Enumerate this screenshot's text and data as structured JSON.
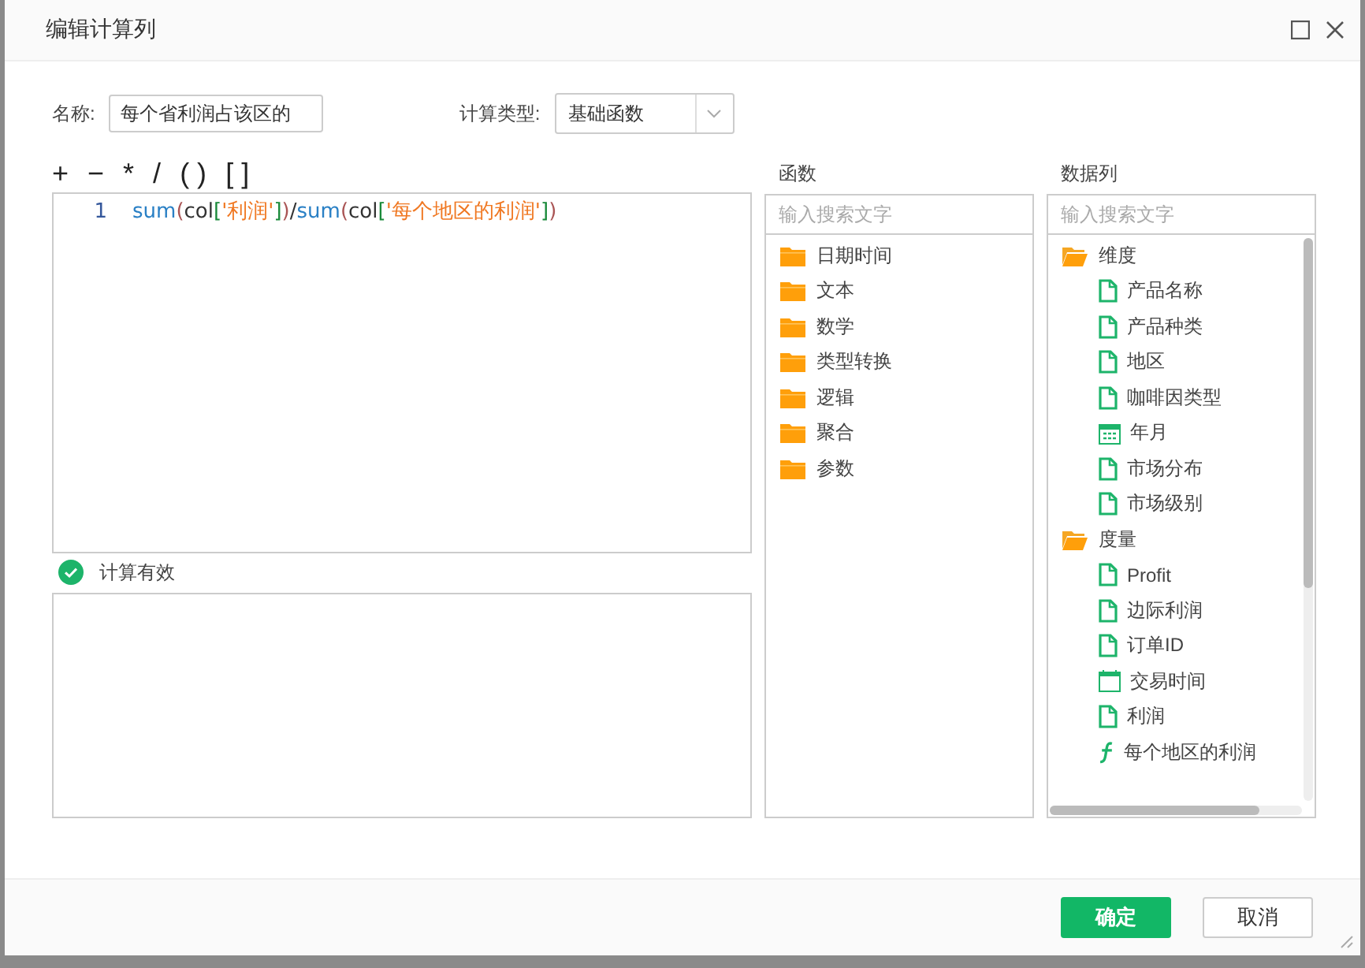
{
  "window": {
    "title": "编辑计算列"
  },
  "name_field": {
    "label": "名称:",
    "value": "每个省利润占该区的"
  },
  "calc_type": {
    "label": "计算类型:",
    "value": "基础函数"
  },
  "operators": [
    "+",
    "−",
    "*",
    "/",
    "( )",
    "[ ]"
  ],
  "editor": {
    "lines": [
      {
        "number": "1",
        "tokens": [
          {
            "kind": "func",
            "text": "sum"
          },
          {
            "kind": "paren",
            "text": "("
          },
          {
            "kind": "plain",
            "text": "col"
          },
          {
            "kind": "bracket",
            "text": "["
          },
          {
            "kind": "string",
            "text": "'利润'"
          },
          {
            "kind": "bracket",
            "text": "]"
          },
          {
            "kind": "paren",
            "text": ")"
          },
          {
            "kind": "plain",
            "text": "/"
          },
          {
            "kind": "func",
            "text": "sum"
          },
          {
            "kind": "paren",
            "text": "("
          },
          {
            "kind": "plain",
            "text": "col"
          },
          {
            "kind": "bracket",
            "text": "["
          },
          {
            "kind": "string",
            "text": "'每个地区的利润'"
          },
          {
            "kind": "bracket",
            "text": "]"
          },
          {
            "kind": "paren",
            "text": ")"
          }
        ]
      }
    ]
  },
  "validation": {
    "valid": true,
    "message": "计算有效"
  },
  "functions": {
    "title": "函数",
    "placeholder": "输入搜索文字",
    "items": [
      {
        "label": "日期时间",
        "expanded": false
      },
      {
        "label": "文本",
        "expanded": false
      },
      {
        "label": "数学",
        "expanded": false
      },
      {
        "label": "类型转换",
        "expanded": false
      },
      {
        "label": "逻辑",
        "expanded": false
      },
      {
        "label": "聚合",
        "expanded": false
      },
      {
        "label": "参数",
        "expanded": false
      }
    ]
  },
  "data_columns": {
    "title": "数据列",
    "placeholder": "输入搜索文字",
    "items": [
      {
        "label": "维度",
        "expanded": true,
        "children": [
          {
            "label": "产品名称",
            "kind": "text"
          },
          {
            "label": "产品种类",
            "kind": "text"
          },
          {
            "label": "地区",
            "kind": "text"
          },
          {
            "label": "咖啡因类型",
            "kind": "text"
          },
          {
            "label": "年月",
            "kind": "month"
          },
          {
            "label": "市场分布",
            "kind": "text"
          },
          {
            "label": "市场级别",
            "kind": "text"
          }
        ]
      },
      {
        "label": "度量",
        "expanded": true,
        "children": [
          {
            "label": "Profit",
            "kind": "text"
          },
          {
            "label": "边际利润",
            "kind": "text"
          },
          {
            "label": "订单ID",
            "kind": "text"
          },
          {
            "label": "交易时间",
            "kind": "date"
          },
          {
            "label": "利润",
            "kind": "text"
          },
          {
            "label": "每个地区的利润",
            "kind": "formula"
          }
        ]
      }
    ]
  },
  "buttons": [
    {
      "label": "确定",
      "primary": true
    },
    {
      "label": "取消",
      "primary": false
    }
  ]
}
